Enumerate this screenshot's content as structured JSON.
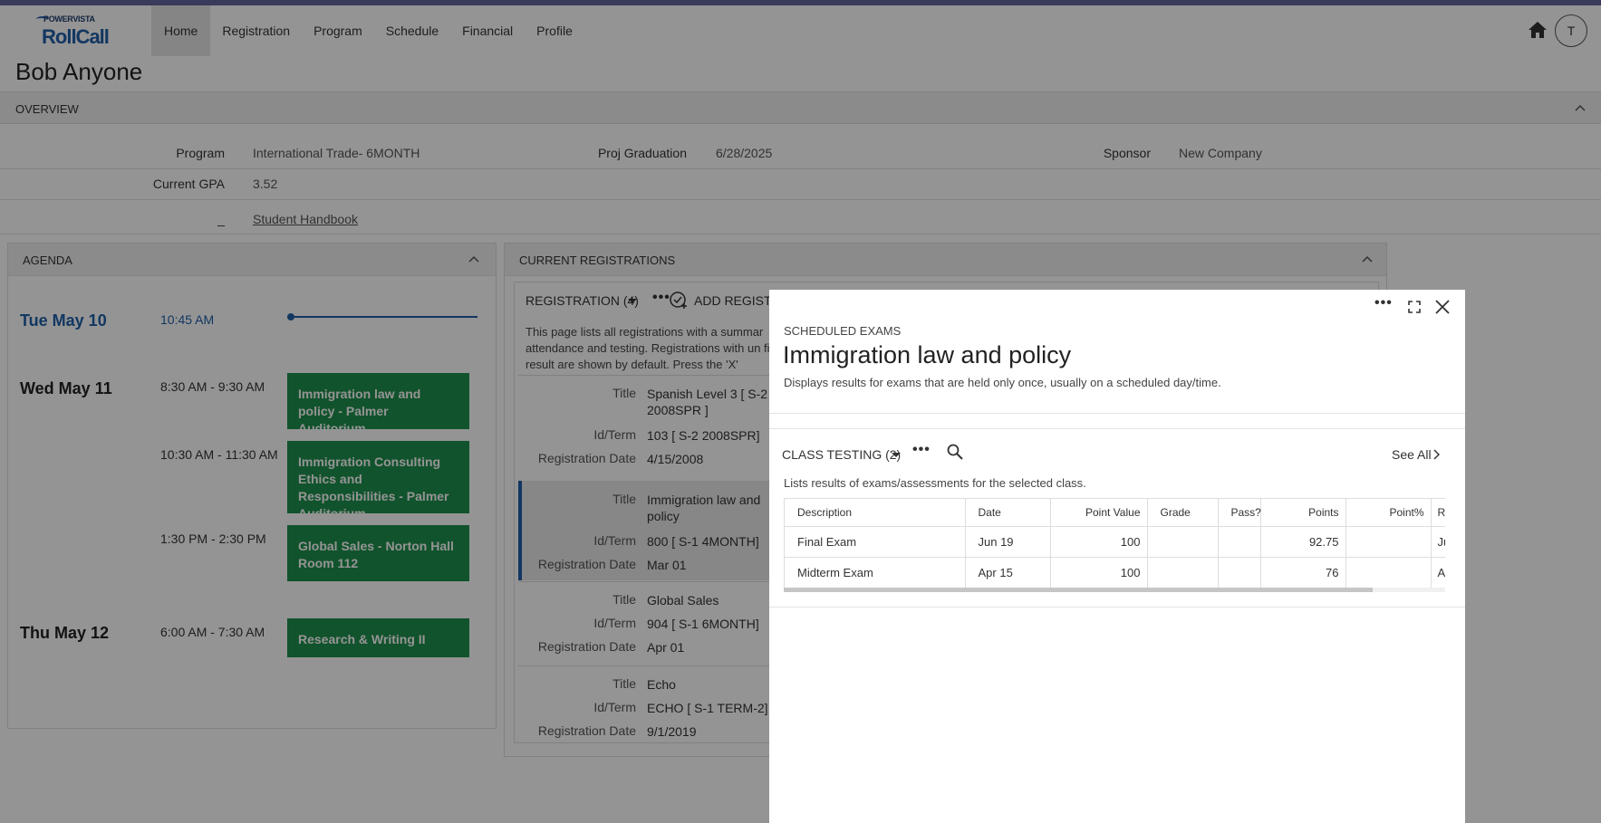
{
  "app": {
    "logo_sub": "POWERVISTA",
    "logo_main": "RollCall"
  },
  "nav": {
    "items": [
      {
        "label": "Home"
      },
      {
        "label": "Registration"
      },
      {
        "label": "Program"
      },
      {
        "label": "Schedule"
      },
      {
        "label": "Financial"
      },
      {
        "label": "Profile"
      }
    ],
    "active": "Home",
    "avatar_initial": "T"
  },
  "person": {
    "name": "Bob Anyone"
  },
  "overview": {
    "title": "OVERVIEW",
    "program_label": "Program",
    "program_value": "International Trade- 6MONTH",
    "proj_grad_label": "Proj Graduation",
    "proj_grad_value": "6/28/2025",
    "sponsor_label": "Sponsor",
    "sponsor_value": "New Company",
    "gpa_label": "Current GPA",
    "gpa_value": "3.52",
    "handbook_label": "_",
    "handbook_link": "Student Handbook"
  },
  "agenda": {
    "title": "AGENDA",
    "days": [
      {
        "label": "Tue May 10",
        "now_time": "10:45 AM"
      },
      {
        "label": "Wed May 11"
      },
      {
        "label": "Thu May 12"
      }
    ],
    "events": [
      {
        "time": "8:30 AM - 9:30 AM",
        "title": "Immigration law and policy - Palmer Auditorium"
      },
      {
        "time": "10:30 AM - 11:30 AM",
        "title": "Immigration Consulting Ethics and Responsibilities - Palmer Auditorium"
      },
      {
        "time": "1:30 PM - 2:30 PM",
        "title": "Global Sales - Norton Hall Room 112"
      },
      {
        "time": "6:00 AM - 7:30 AM",
        "title": "Research & Writing II"
      }
    ]
  },
  "registrations": {
    "title": "CURRENT REGISTRATIONS",
    "toolbar_label": "REGISTRATION (4)",
    "add_label": "ADD REGIST",
    "description": "This page lists all registrations with a summar attendance and testing. Registrations with un final result are shown by default. Press the 'X'",
    "field_labels": {
      "title": "Title",
      "id_term": "Id/Term",
      "reg_date": "Registration Date"
    },
    "cards": [
      {
        "title": "Spanish Level 3 [ S-2 2008SPR ]",
        "id_term": "103 [ S-2 2008SPR]",
        "reg_date": "4/15/2008"
      },
      {
        "title": "Immigration law and policy",
        "id_term": "800 [ S-1 4MONTH]",
        "reg_date": "Mar 01"
      },
      {
        "title": "Global Sales",
        "id_term": "904 [ S-1 6MONTH]",
        "reg_date": "Apr 01"
      },
      {
        "title": "Echo",
        "id_term": "ECHO [ S-1 TERM-2]",
        "reg_date": "9/1/2019"
      }
    ]
  },
  "dialog": {
    "kicker": "SCHEDULED EXAMS",
    "title": "Immigration law and policy",
    "description": "Displays results for exams that are held only once, usually on a scheduled day/time.",
    "class_testing_label": "CLASS TESTING (2)",
    "see_all": "See All",
    "class_testing_desc": "Lists results of exams/assessments for the selected class.",
    "columns": [
      "Description",
      "Date",
      "Point Value",
      "Grade",
      "Pass?",
      "Points",
      "Point%",
      "R"
    ],
    "rows": [
      {
        "description": "Final Exam",
        "date": "Jun 19",
        "point_value": "100",
        "grade": "",
        "pass": "",
        "points": "92.75",
        "point_pct": "",
        "r": "Ju"
      },
      {
        "description": "Midterm Exam",
        "date": "Apr 15",
        "point_value": "100",
        "grade": "",
        "pass": "",
        "points": "76",
        "point_pct": "",
        "r": "A"
      }
    ]
  }
}
